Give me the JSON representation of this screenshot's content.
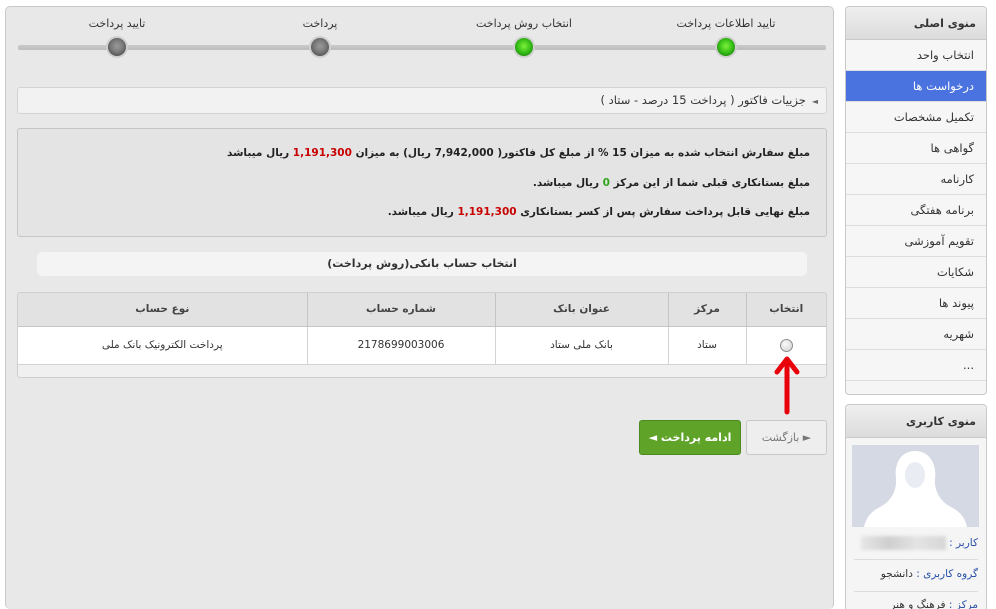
{
  "steps": [
    {
      "label": "تایید اطلاعات پرداخت",
      "status": "done"
    },
    {
      "label": "انتخاب روش پرداخت",
      "status": "done"
    },
    {
      "label": "پرداخت",
      "status": "pending"
    },
    {
      "label": "تایید پرداخت",
      "status": "pending"
    }
  ],
  "breadcrumb": {
    "text": "جزییات فاکتور ( پرداخت 15 درصد - ستاد )"
  },
  "info": {
    "line1_prefix": "مبلغ سفارش انتخاب شده به میزان 15 % از مبلغ کل فاکتور( 7,942,000 ریال) به میزان",
    "line1_amount": "1,191,300",
    "line1_suffix": "ریال میباشد",
    "line2_prefix": "مبلغ بستانکاری قبلی شما از این مرکز",
    "line2_amount": "0",
    "line2_suffix": "ریال میباشد.",
    "line3_prefix": "مبلغ نهایی قابل پرداخت سفارش پس از کسر بستانکاری",
    "line3_amount": "1,191,300",
    "line3_suffix": "ریال میباشد."
  },
  "section_title": "انتخاب حساب بانکی(روش پرداخت)",
  "table": {
    "headers": {
      "select": "انتخاب",
      "center": "مرکز",
      "bank": "عنوان بانک",
      "account": "شماره حساب",
      "type": "نوع حساب"
    },
    "rows": [
      {
        "center": "ستاد",
        "bank": "بانک ملی ستاد",
        "account": "2178699003006",
        "type": "پرداخت الکترونیک بانک ملی"
      }
    ]
  },
  "buttons": {
    "continue": "ادامه پرداخت ◄",
    "back": "► بازگشت"
  },
  "main_menu": {
    "title": "منوی اصلی",
    "items": [
      {
        "label": "انتخاب واحد",
        "active": false
      },
      {
        "label": "درخواست ها",
        "active": true
      },
      {
        "label": "تکمیل مشخصات",
        "active": false
      },
      {
        "label": "گواهی ها",
        "active": false
      },
      {
        "label": "کارنامه",
        "active": false
      },
      {
        "label": "برنامه هفتگی",
        "active": false
      },
      {
        "label": "تقویم آموزشی",
        "active": false
      },
      {
        "label": "شکایات",
        "active": false
      },
      {
        "label": "پیوند ها",
        "active": false
      },
      {
        "label": "شهریه",
        "active": false
      },
      {
        "label": "...",
        "active": false
      }
    ]
  },
  "user_menu": {
    "title": "منوی کاربری",
    "user_label": "کاربر :",
    "group_label": "گروه کاربری :",
    "group_value": "دانشجو",
    "center_label": "مرکز :",
    "center_value": "فرهنگ و هنر"
  },
  "colors": {
    "active_menu": "#4a73e0",
    "continue_button": "#5fa329",
    "amount_red": "#c80000",
    "amount_green": "#2fa51a",
    "annotation_arrow": "#e8000b"
  }
}
